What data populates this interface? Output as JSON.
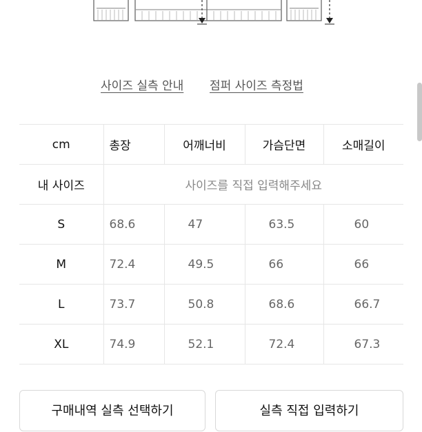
{
  "links": {
    "measure_guide": "사이즈 실측 안내",
    "jumper_guide": "점퍼 사이즈 측정법"
  },
  "table": {
    "unit": "cm",
    "columns": [
      "총장",
      "어깨너비",
      "가슴단면",
      "소매길이"
    ],
    "my_size_label": "내 사이즈",
    "my_size_placeholder": "사이즈를 직접 입력해주세요",
    "rows": [
      {
        "size": "S",
        "values": [
          "68.6",
          "47",
          "63.5",
          "60"
        ]
      },
      {
        "size": "M",
        "values": [
          "72.4",
          "49.5",
          "66",
          "66"
        ]
      },
      {
        "size": "L",
        "values": [
          "73.7",
          "50.8",
          "68.6",
          "66.7"
        ]
      },
      {
        "size": "XL",
        "values": [
          "74.9",
          "52.1",
          "72.4",
          "67.3"
        ]
      }
    ]
  },
  "buttons": {
    "purchase_history": "구매내역 실측 선택하기",
    "direct_input": "실측 직접 입력하기"
  }
}
